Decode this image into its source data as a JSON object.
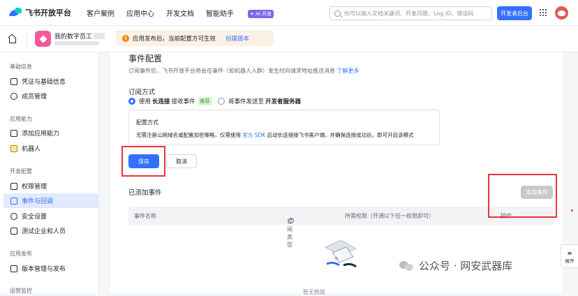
{
  "topbar": {
    "brand": "飞书开放平台",
    "nav": [
      "客户案例",
      "应用中心",
      "开发文档",
      "智能助手"
    ],
    "ai_badge": "✦ AI 开发",
    "search_placeholder": "你可以输入文档关键词、开发问题、Log ID、错误码",
    "dev_console": "开发者后台"
  },
  "app": {
    "name": "我的数字员工"
  },
  "notice": {
    "text": "应用发布后，当前配置方可生效",
    "link": "创建版本"
  },
  "sidebar": {
    "sections": [
      {
        "title": "基础信息",
        "items": [
          "凭证与基础信息",
          "成员管理"
        ]
      },
      {
        "title": "应用能力",
        "items": [
          "添加应用能力",
          "机器人"
        ]
      },
      {
        "title": "开发配置",
        "items": [
          "权限管理",
          "事件与回调",
          "安全设置",
          "测试企业和人员"
        ]
      },
      {
        "title": "应用发布",
        "items": [
          "版本管理与发布"
        ]
      },
      {
        "title": "运营监控",
        "items": []
      }
    ],
    "active": "事件与回调"
  },
  "main": {
    "title": "事件配置",
    "desc": "订阅事件后，飞书开放平台将会在事件（如机器人入群）发生时向请求地址推送消息",
    "desc_link": "了解更多",
    "subscribe_title": "订阅方式",
    "option1_prefix": "使用",
    "option1_bold": "长连接",
    "option1_suffix": "接收事件",
    "option1_tag": "推荐",
    "option2_prefix": "将事件发送至",
    "option2_bold": "开发者服务器",
    "config_title": "配置方式",
    "config_desc_a": "无需注册公网域名或配置加密策略，仅需使用",
    "config_desc_link": "官方 SDK",
    "config_desc_b": "启动长连接接飞书客户端，并确保连接成功后，即可开启该模式",
    "save": "保存",
    "cancel": "取消",
    "added_title": "已添加事件",
    "add_event": "添加事件",
    "columns": [
      "事件名称",
      "订阅类型",
      "所需权限（开通以下任一权限即可）",
      "操作"
    ],
    "empty_text": "暂无数据"
  },
  "expand": {
    "label": "展开"
  },
  "watermark": {
    "text": "公众号 · 网安武器库"
  }
}
